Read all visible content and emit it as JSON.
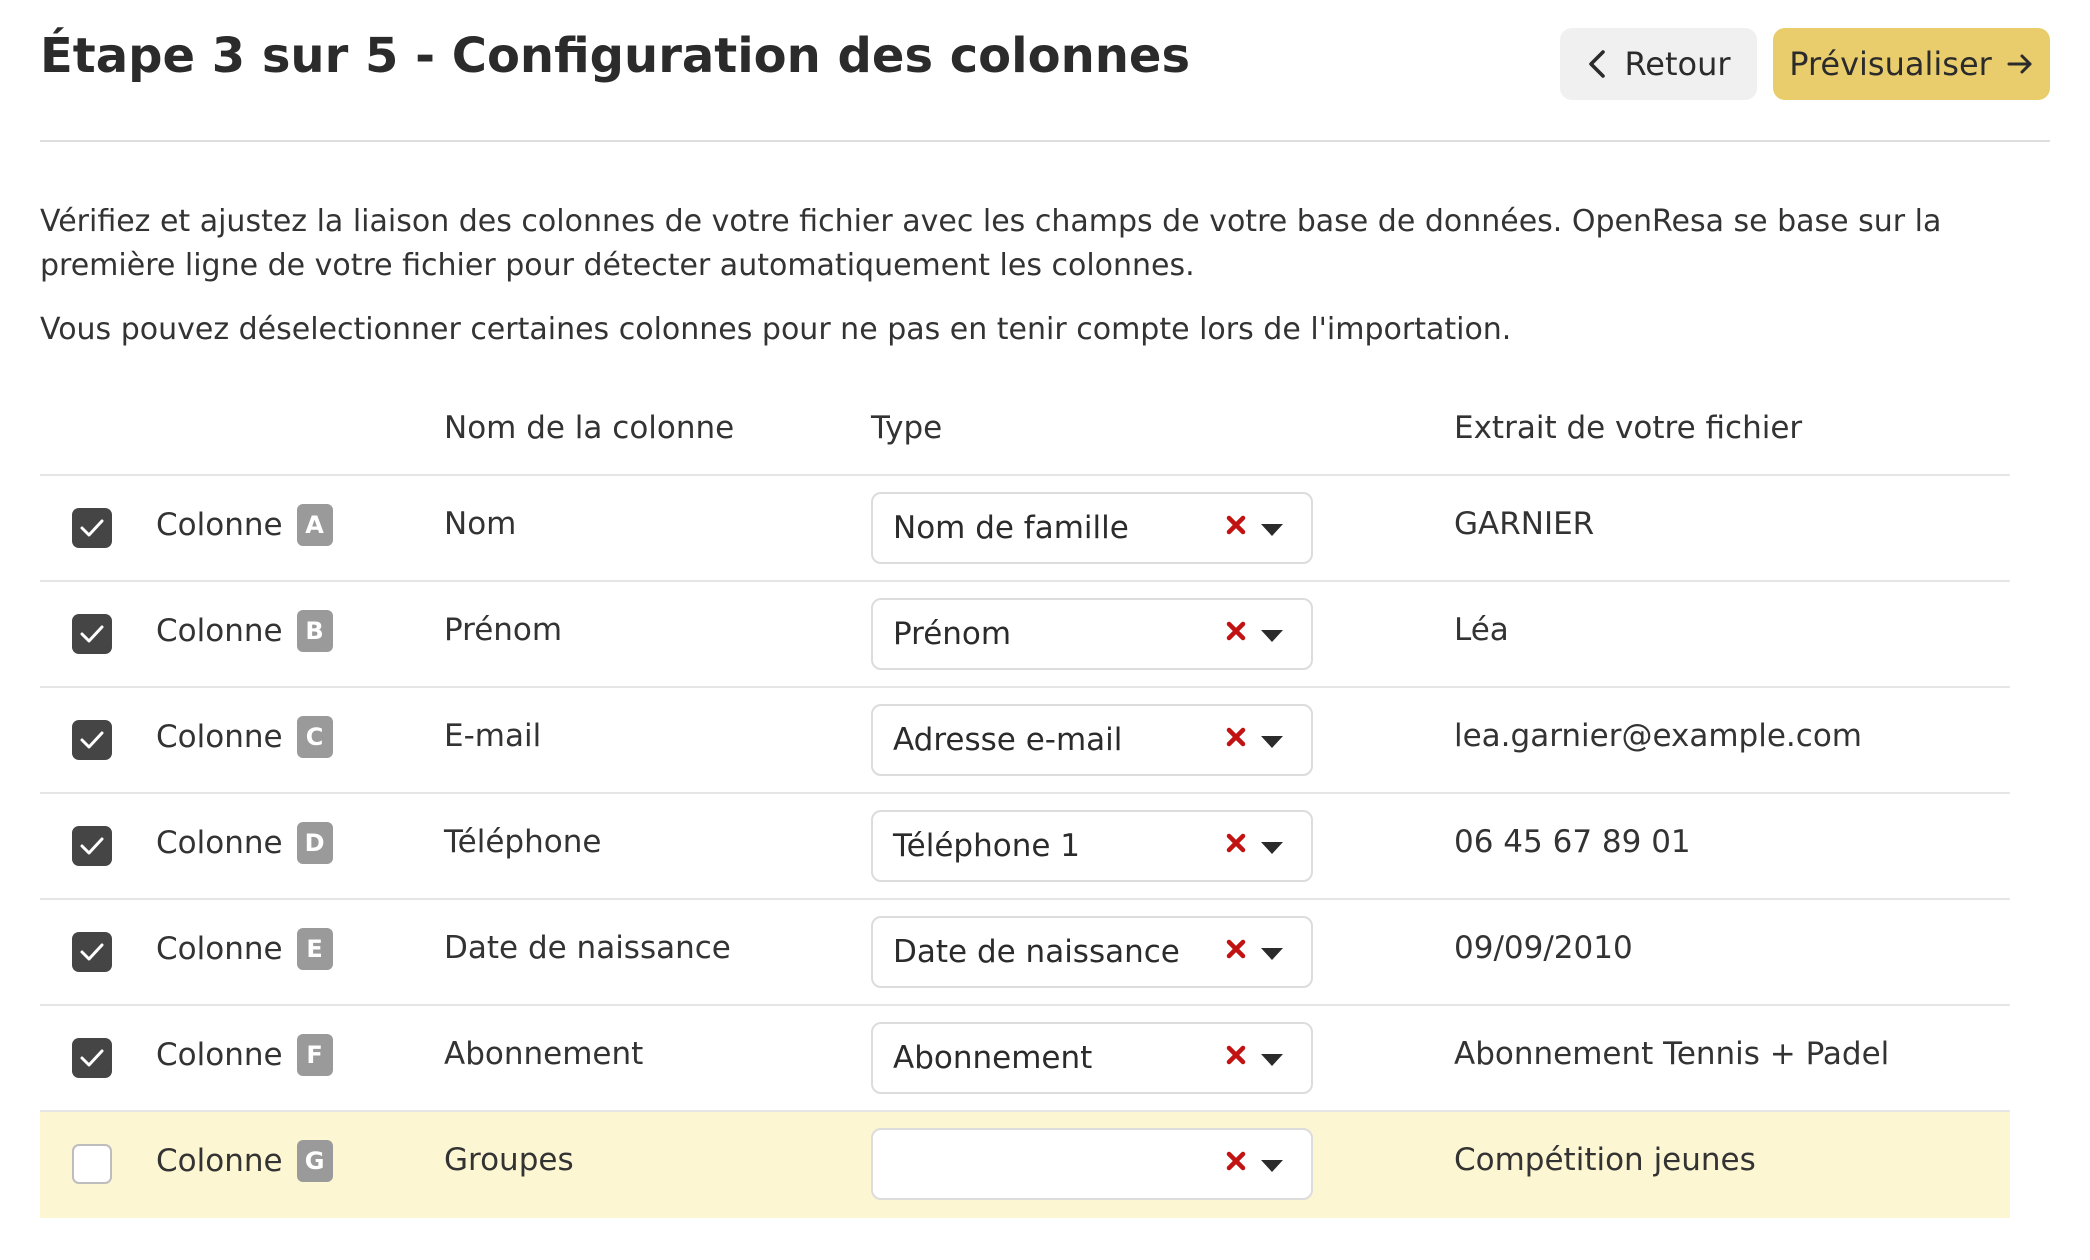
{
  "header": {
    "title": "Étape 3 sur 5 - Configuration des colonnes",
    "back_label": "Retour",
    "preview_label": "Prévisualiser"
  },
  "intro": {
    "paragraph_1": "Vérifiez et ajustez la liaison des colonnes de votre fichier avec les champs de votre base de données. OpenResa se base sur la première ligne de votre fichier pour détecter automatiquement les colonnes.",
    "paragraph_2": "Vous pouvez déselectionner certaines colonnes pour ne pas en tenir compte lors de l'importation."
  },
  "table": {
    "headers": {
      "name": "Nom de la colonne",
      "type": "Type",
      "extract": "Extrait de votre fichier"
    },
    "rows": [
      {
        "checked": true,
        "column_word": "Colonne",
        "letter": "A",
        "name": "Nom",
        "type": "Nom de famille",
        "extract": "GARNIER"
      },
      {
        "checked": true,
        "column_word": "Colonne",
        "letter": "B",
        "name": "Prénom",
        "type": "Prénom",
        "extract": "Léa"
      },
      {
        "checked": true,
        "column_word": "Colonne",
        "letter": "C",
        "name": "E-mail",
        "type": "Adresse e-mail",
        "extract": "lea.garnier@example.com"
      },
      {
        "checked": true,
        "column_word": "Colonne",
        "letter": "D",
        "name": "Téléphone",
        "type": "Téléphone 1",
        "extract": "06 45 67 89 01"
      },
      {
        "checked": true,
        "column_word": "Colonne",
        "letter": "E",
        "name": "Date de naissance",
        "type": "Date de naissance",
        "extract": "09/09/2010"
      },
      {
        "checked": true,
        "column_word": "Colonne",
        "letter": "F",
        "name": "Abonnement",
        "type": "Abonnement",
        "extract": "Abonnement Tennis + Padel"
      },
      {
        "checked": false,
        "column_word": "Colonne",
        "letter": "G",
        "name": "Groupes",
        "type": "",
        "extract": "Compétition jeunes"
      }
    ]
  },
  "colors": {
    "accent": "#e9cd6c",
    "checkbox_checked": "#454545",
    "clear_icon": "#c21313",
    "deselected_row": "#fdf6d3"
  },
  "icons": {
    "back": "chevron-left-icon",
    "preview": "arrow-right-icon",
    "check": "check-icon",
    "clear": "clear-x-icon",
    "dropdown": "caret-down-icon"
  }
}
